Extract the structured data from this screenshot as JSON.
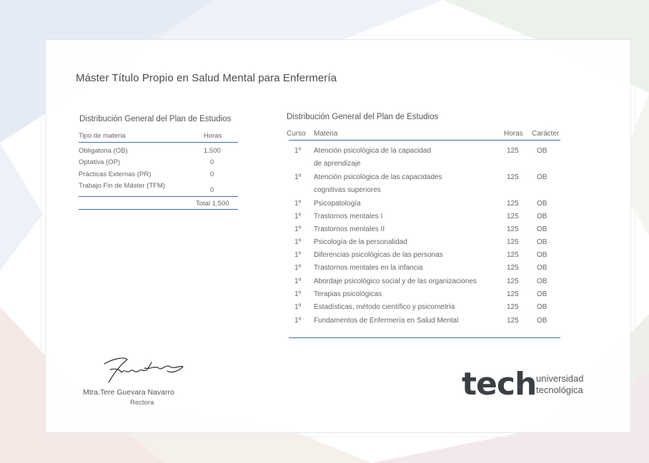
{
  "document": {
    "title": "Máster Título Propio en Salud Mental para Enfermería"
  },
  "summary_table": {
    "heading": "Distribución General del Plan de Estudios",
    "col_type": "Tipo de materia",
    "col_hours": "Horas",
    "rows": [
      {
        "type": "Obligatoria (OB)",
        "hours": "1.500"
      },
      {
        "type": "Optativa (OP)",
        "hours": "0"
      },
      {
        "type": "Prácticas Externas (PR)",
        "hours": "0"
      },
      {
        "type": "Trabajo Fin de Máster (TFM)",
        "hours": "0"
      }
    ],
    "total": "Total 1.500"
  },
  "subjects_table": {
    "heading": "Distribución General del Plan de Estudios",
    "col_course": "Curso",
    "col_subject": "Materia",
    "col_hours": "Horas",
    "col_type": "Carácter",
    "rows": [
      {
        "course": "1º",
        "subject": "Atención psicológica de la capacidad",
        "subject2": "de aprendizaje",
        "hours": "125",
        "type": "OB"
      },
      {
        "course": "1º",
        "subject": "Atención psicológica de las capacidades",
        "subject2": "cognitivas superiores",
        "hours": "125",
        "type": "OB"
      },
      {
        "course": "1º",
        "subject": "Psicopatología",
        "hours": "125",
        "type": "OB"
      },
      {
        "course": "1º",
        "subject": "Trastornos mentales I",
        "hours": "125",
        "type": "OB"
      },
      {
        "course": "1º",
        "subject": "Trastornos mentales II",
        "hours": "125",
        "type": "OB"
      },
      {
        "course": "1º",
        "subject": "Psicología de la personalidad",
        "hours": "125",
        "type": "OB"
      },
      {
        "course": "1º",
        "subject": "Diferencias psicológicas de las personas",
        "hours": "125",
        "type": "OB"
      },
      {
        "course": "1º",
        "subject": "Trastornos mentales en la infancia",
        "hours": "125",
        "type": "OB"
      },
      {
        "course": "1º",
        "subject": "Abordaje psicológico social y de las organizaciones",
        "hours": "125",
        "type": "OB"
      },
      {
        "course": "1º",
        "subject": "Terapias psicológicas",
        "hours": "125",
        "type": "OB"
      },
      {
        "course": "1º",
        "subject": "Estadísticas, método científico y psicometría",
        "hours": "125",
        "type": "OB"
      },
      {
        "course": "1º",
        "subject": "Fundamentos de Enfermería en Salud Mental",
        "hours": "125",
        "type": "OB"
      }
    ]
  },
  "signature": {
    "name": "Mtra.Tere Guevara Navarro",
    "role": "Rectora"
  },
  "logo": {
    "word": "tech",
    "line1": "universidad",
    "line2": "tecnológica",
    "accent": "#2fa8e0"
  },
  "colors": {
    "rule": "#3b6fb6"
  }
}
